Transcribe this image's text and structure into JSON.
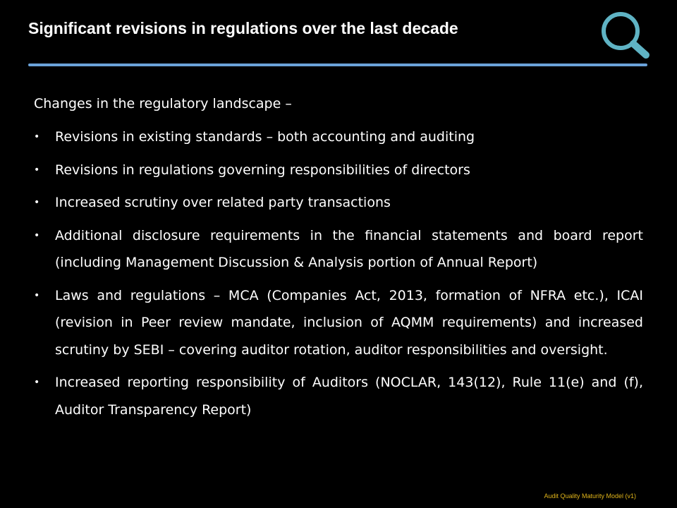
{
  "slide": {
    "title": "Significant revisions in regulations over the last decade",
    "intro": "Changes in the regulatory landscape –",
    "bullets": [
      "Revisions in existing standards – both accounting and auditing",
      "Revisions in regulations governing responsibilities of directors",
      "Increased scrutiny over related party transactions",
      "Additional disclosure requirements in the financial statements and board report (including Management Discussion & Analysis portion of Annual Report)",
      "Laws and regulations – MCA (Companies Act, 2013, formation of NFRA etc.), ICAI (revision in Peer review mandate, inclusion of AQMM requirements) and increased scrutiny by SEBI – covering auditor rotation, auditor responsibilities and oversight.",
      "Increased reporting responsibility of Auditors (NOCLAR, 143(12), Rule 11(e) and (f), Auditor Transparency Report)"
    ],
    "footer": "Audit Quality Maturity Model (v1)"
  },
  "icons": {
    "search": "search-icon"
  },
  "colors": {
    "background": "#000000",
    "text": "#ffffff",
    "accent_rule": "#6aa2d9",
    "icon": "#5fb3c4",
    "footer": "#e0b41a"
  }
}
